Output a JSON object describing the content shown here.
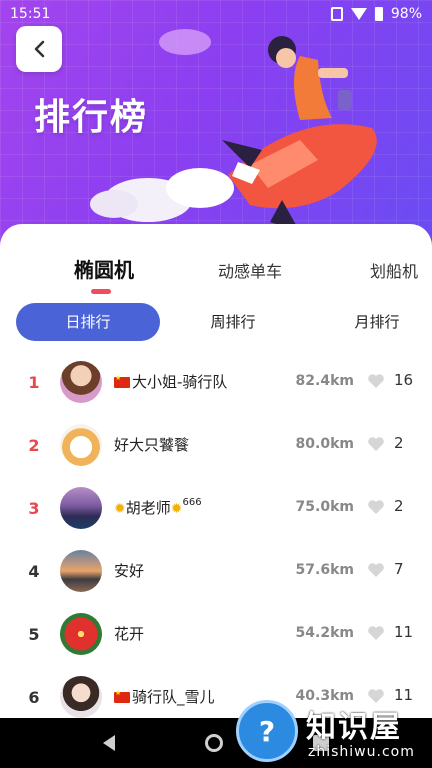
{
  "status_bar": {
    "time": "15:51",
    "battery": "98%"
  },
  "header": {
    "title": "排行榜"
  },
  "tabs": [
    {
      "label": "椭圆机",
      "active": true
    },
    {
      "label": "动感单车",
      "active": false
    },
    {
      "label": "划船机",
      "active": false
    }
  ],
  "periods": [
    {
      "label": "日排行",
      "active": true
    },
    {
      "label": "周排行",
      "active": false
    },
    {
      "label": "月排行",
      "active": false
    }
  ],
  "rankings": [
    {
      "rank": "1",
      "name": "大小姐-骑行队",
      "distance": "82.4km",
      "likes": "16"
    },
    {
      "rank": "2",
      "name": "好大只饕餮",
      "distance": "80.0km",
      "likes": "2"
    },
    {
      "rank": "3",
      "name": "胡老师",
      "suffix": "666",
      "distance": "75.0km",
      "likes": "2"
    },
    {
      "rank": "4",
      "name": "安好",
      "distance": "57.6km",
      "likes": "7"
    },
    {
      "rank": "5",
      "name": "花开",
      "distance": "54.2km",
      "likes": "11"
    },
    {
      "rank": "6",
      "name": "骑行队_雪儿",
      "distance": "40.3km",
      "likes": "11"
    }
  ],
  "watermark": {
    "title": "知识屋",
    "subtitle": "zhishiwu.com"
  },
  "colors": {
    "accent": "#4a63d6",
    "rank_top": "#e5484d",
    "hero_start": "#a445ee",
    "hero_end": "#6a4cf3"
  }
}
